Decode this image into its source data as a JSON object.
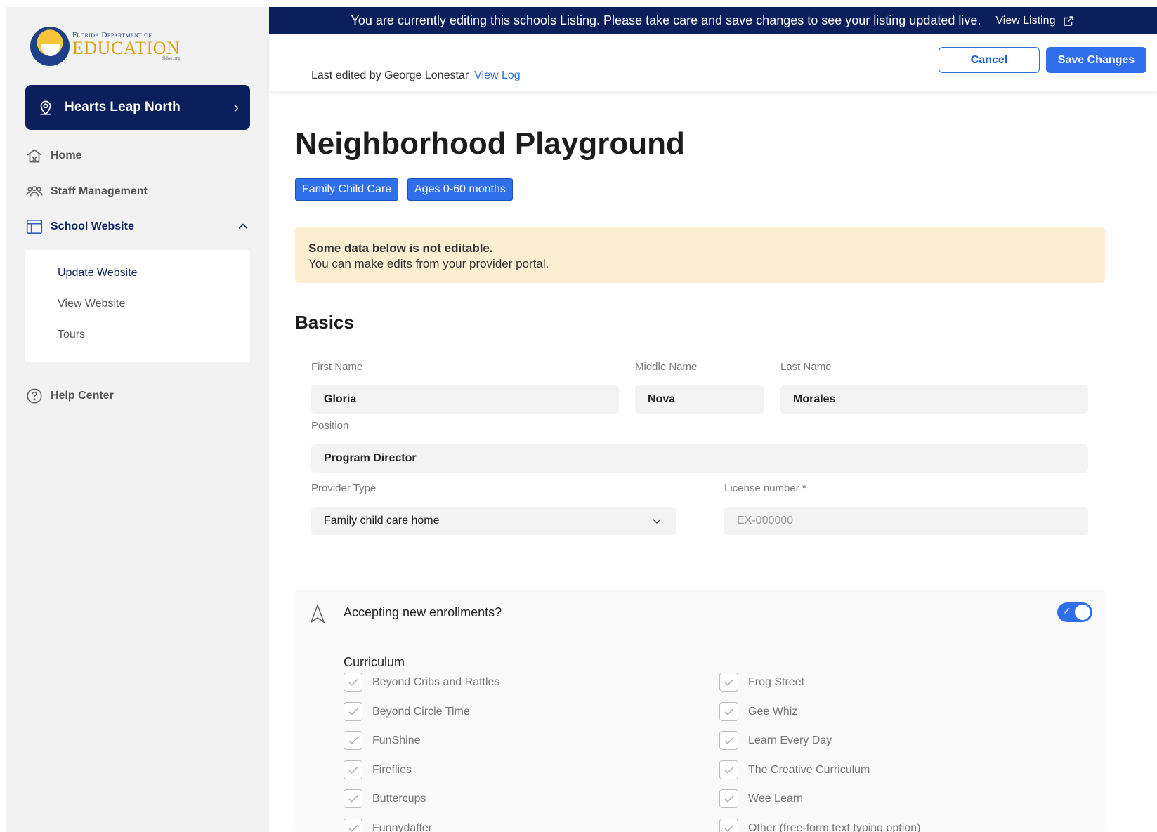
{
  "banner": {
    "message": "You are currently editing this schools Listing. Please take care and save changes to see your listing updated live.",
    "link_label": "View Listing"
  },
  "logo": {
    "top": "Florida Department of",
    "main": "EDUCATION",
    "sub": "fldoe.org"
  },
  "sidebar": {
    "school_name": "Hearts Leap North",
    "nav": {
      "home": "Home",
      "staff": "Staff Management",
      "school_website": "School Website",
      "help": "Help Center"
    },
    "subnav": {
      "update": "Update Website",
      "view": "View Website",
      "tours": "Tours"
    }
  },
  "header": {
    "last_edited": "Last edited by George Lonestar",
    "view_log": "View Log",
    "cancel": "Cancel",
    "save": "Save Changes"
  },
  "page": {
    "title": "Neighborhood Playground",
    "tags": [
      "Family Child Care",
      "Ages 0-60 months"
    ],
    "notice_strong": "Some data below is not editable.",
    "notice_text": "You can make edits from your provider portal.",
    "section": "Basics"
  },
  "form": {
    "first_name": {
      "label": "First Name",
      "value": "Gloria"
    },
    "middle_name": {
      "label": "Middle Name",
      "value": "Nova"
    },
    "last_name": {
      "label": "Last Name",
      "value": "Morales"
    },
    "position": {
      "label": "Position",
      "value": "Program Director"
    },
    "provider_type": {
      "label": "Provider Type",
      "value": "Family child care home"
    },
    "license": {
      "label": "License number *",
      "placeholder": "EX-000000"
    }
  },
  "enrollment": {
    "question": "Accepting new enrollments?",
    "accepting": true,
    "curriculum_title": "Curriculum",
    "left": [
      "Beyond Cribs and Rattles",
      "Beyond Circle Time",
      "FunShine",
      "Fireflies",
      "Buttercups",
      "Funnydaffer"
    ],
    "right": [
      "Frog Street",
      "Gee Whiz",
      "Learn Every Day",
      "The Creative Curriculum",
      "Wee Learn",
      "Other (free-form text typing option)"
    ]
  },
  "colors": {
    "navy": "#0a1f5c",
    "primary": "#2f6fec",
    "notice_bg": "#fcefd1"
  }
}
